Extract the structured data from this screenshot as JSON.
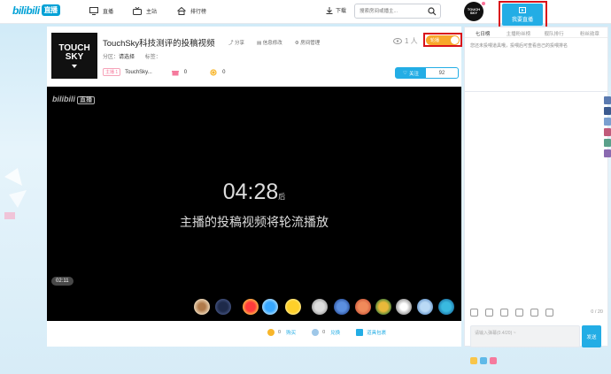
{
  "nav": {
    "logo": "bilibili",
    "logo_live": "直播",
    "items": [
      {
        "label": "直播",
        "icon": "monitor-icon"
      },
      {
        "label": "主站",
        "icon": "tv-icon"
      },
      {
        "label": "排行榜",
        "icon": "house-icon"
      }
    ],
    "download": "下载",
    "search_placeholder": "搜索房间或播主...",
    "user_avatar": [
      "TOUCH",
      "SKY"
    ],
    "my_live": "我要直播"
  },
  "room": {
    "avatar_line1": "TOUCH",
    "avatar_line2": "SKY",
    "title": "TouchSky科技测评的投稿视频",
    "actions": [
      "分享",
      "信息修改",
      "房间管理"
    ],
    "category_label": "分区：",
    "category_value": "请选择",
    "tags_label": "标签：",
    "level_badge": "主播 1",
    "anchor_name": "TouchSky...",
    "gift_count": "0",
    "coin_count": "0",
    "viewers": "1 人",
    "rotate_label": "轮播",
    "follow_label": "关注",
    "followers": "92"
  },
  "player": {
    "watermark": "bilibili",
    "watermark_tag": "直播",
    "countdown": "04:28",
    "countdown_suffix": "后",
    "message": "主播的投稿视频将轮流播放",
    "timer": "02:11"
  },
  "bottom": {
    "silver_count": "0",
    "silver_label": "购买",
    "gold_count": "0",
    "gold_label": "兑换",
    "prop_label": "道具包裹"
  },
  "side": {
    "tabs": [
      "七日榜",
      "主播粉丝榜",
      "舰队排行",
      "粉丝勋章"
    ],
    "notice": "您还未投喂道具哦，投喂后可查看自己的投喂排名",
    "char_count": "0 / 20",
    "input_placeholder": "请输入弹幕(0.4/20) ~",
    "send_label": "发送"
  },
  "colors": {
    "accent": "#23ade5",
    "highlight_box": "#d9121a",
    "switch": "#f8a72b"
  }
}
